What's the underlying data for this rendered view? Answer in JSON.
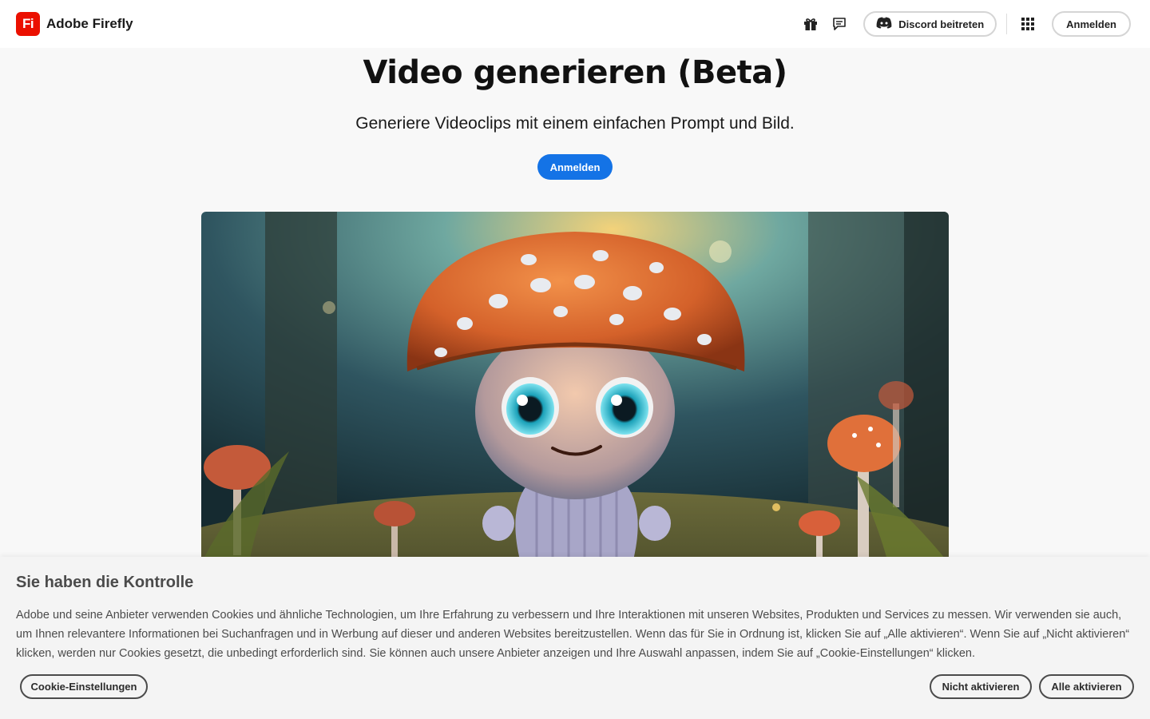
{
  "header": {
    "logo_text": "Fi",
    "app_name": "Adobe Firefly",
    "discord_label": "Discord beitreten",
    "signin_label": "Anmelden",
    "icons": [
      "gift-icon",
      "feedback-icon",
      "discord-icon",
      "app-grid-icon"
    ]
  },
  "hero": {
    "title": "Video generieren (Beta)",
    "subtitle": "Generiere Videoclips mit einem einfachen Prompt und Bild.",
    "cta_label": "Anmelden"
  },
  "cookie": {
    "title": "Sie haben die Kontrolle",
    "body": "Adobe und seine Anbieter verwenden Cookies und ähnliche Technologien, um Ihre Erfahrung zu verbessern und Ihre Interaktionen mit unseren Websites, Produkten und Services zu messen. Wir verwenden sie auch, um Ihnen relevantere Informationen bei Suchanfragen und in Werbung auf dieser und anderen Websites bereitzustellen. Wenn das für Sie in Ordnung ist, klicken Sie auf „Alle aktivieren“. Wenn Sie auf „Nicht aktivieren“ klicken, werden nur Cookies gesetzt, die unbedingt erforderlich sind. Sie können auch unsere Anbieter anzeigen und Ihre Auswahl anpassen, indem Sie auf „Cookie-Einstellungen“ klicken.",
    "settings_label": "Cookie-Einstellungen",
    "decline_label": "Nicht aktivieren",
    "accept_label": "Alle aktivieren"
  },
  "colors": {
    "brand_red": "#eb1000",
    "cta_blue": "#1473e6",
    "page_bg": "#f8f8f8"
  }
}
